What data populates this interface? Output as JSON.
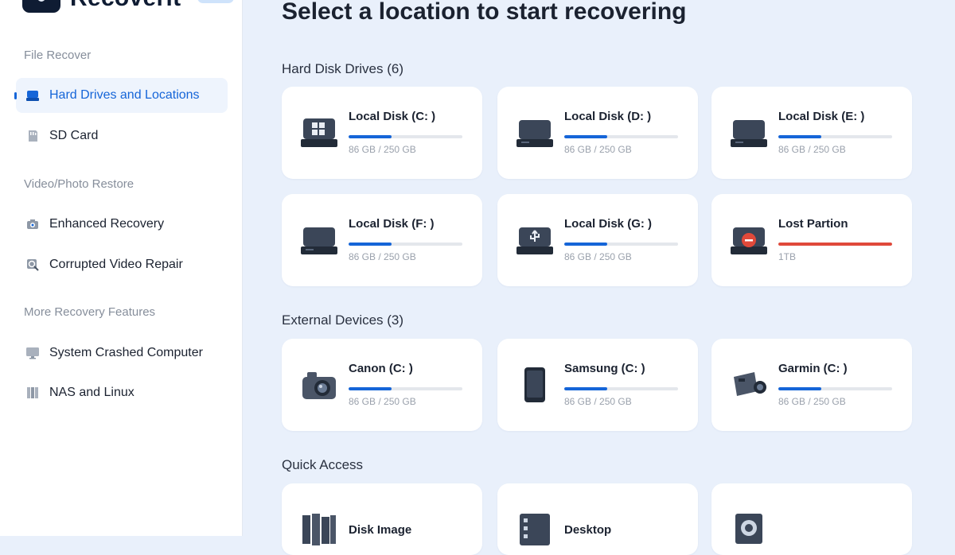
{
  "app": {
    "name": "Recoverit"
  },
  "colors": {
    "accent": "#1565d8",
    "lost": "#e0493a",
    "page_bg": "#e9f0fb",
    "card_bg": "#ffffff"
  },
  "sidebar": {
    "file_recover_label": "File Recover",
    "file_recover_items": [
      {
        "label": "Hard Drives and Locations",
        "icon": "hard-drive-icon",
        "active": true
      },
      {
        "label": "SD Card",
        "icon": "sd-card-icon",
        "active": false
      }
    ],
    "video_photo_label": "Video/Photo Restore",
    "video_photo_items": [
      {
        "label": "Enhanced Recovery",
        "icon": "enhanced-recovery-icon"
      },
      {
        "label": "Corrupted Video Repair",
        "icon": "video-repair-icon"
      }
    ],
    "more_label": "More Recovery Features",
    "more_items": [
      {
        "label": "System Crashed Computer",
        "icon": "monitor-icon"
      },
      {
        "label": "NAS and Linux",
        "icon": "nas-icon"
      }
    ]
  },
  "main": {
    "title": "Select a location to start recovering",
    "hard_disk": {
      "title": "Hard Disk Drives (6)",
      "items": [
        {
          "name": "Local Disk (C: )",
          "usage": "86 GB / 250 GB",
          "used_fraction": 0.38,
          "icon": "windows-drive-icon"
        },
        {
          "name": "Local Disk (D: )",
          "usage": "86 GB / 250 GB",
          "used_fraction": 0.38,
          "icon": "drive-icon"
        },
        {
          "name": "Local Disk (E: )",
          "usage": "86 GB / 250 GB",
          "used_fraction": 0.38,
          "icon": "drive-icon"
        },
        {
          "name": "Local Disk (F: )",
          "usage": "86 GB / 250 GB",
          "used_fraction": 0.38,
          "icon": "drive-icon"
        },
        {
          "name": "Local Disk (G: )",
          "usage": "86 GB / 250 GB",
          "used_fraction": 0.38,
          "icon": "usb-drive-icon"
        },
        {
          "name": "Lost Partion",
          "usage": "1TB",
          "used_fraction": 1.0,
          "icon": "lost-partition-icon"
        }
      ]
    },
    "external": {
      "title": "External Devices (3)",
      "items": [
        {
          "name": "Canon (C: )",
          "usage": "86 GB / 250 GB",
          "used_fraction": 0.38,
          "icon": "camera-icon"
        },
        {
          "name": "Samsung (C: )",
          "usage": "86 GB / 250 GB",
          "used_fraction": 0.38,
          "icon": "phone-icon"
        },
        {
          "name": "Garmin (C: )",
          "usage": "86 GB / 250 GB",
          "used_fraction": 0.38,
          "icon": "action-camera-icon"
        }
      ]
    },
    "quick": {
      "title": "Quick Access",
      "items": [
        {
          "name": "Disk Image",
          "icon": "disk-image-icon"
        },
        {
          "name": "Desktop",
          "icon": "desktop-icon"
        },
        {
          "name": "",
          "icon": "select-folder-icon"
        }
      ]
    }
  }
}
